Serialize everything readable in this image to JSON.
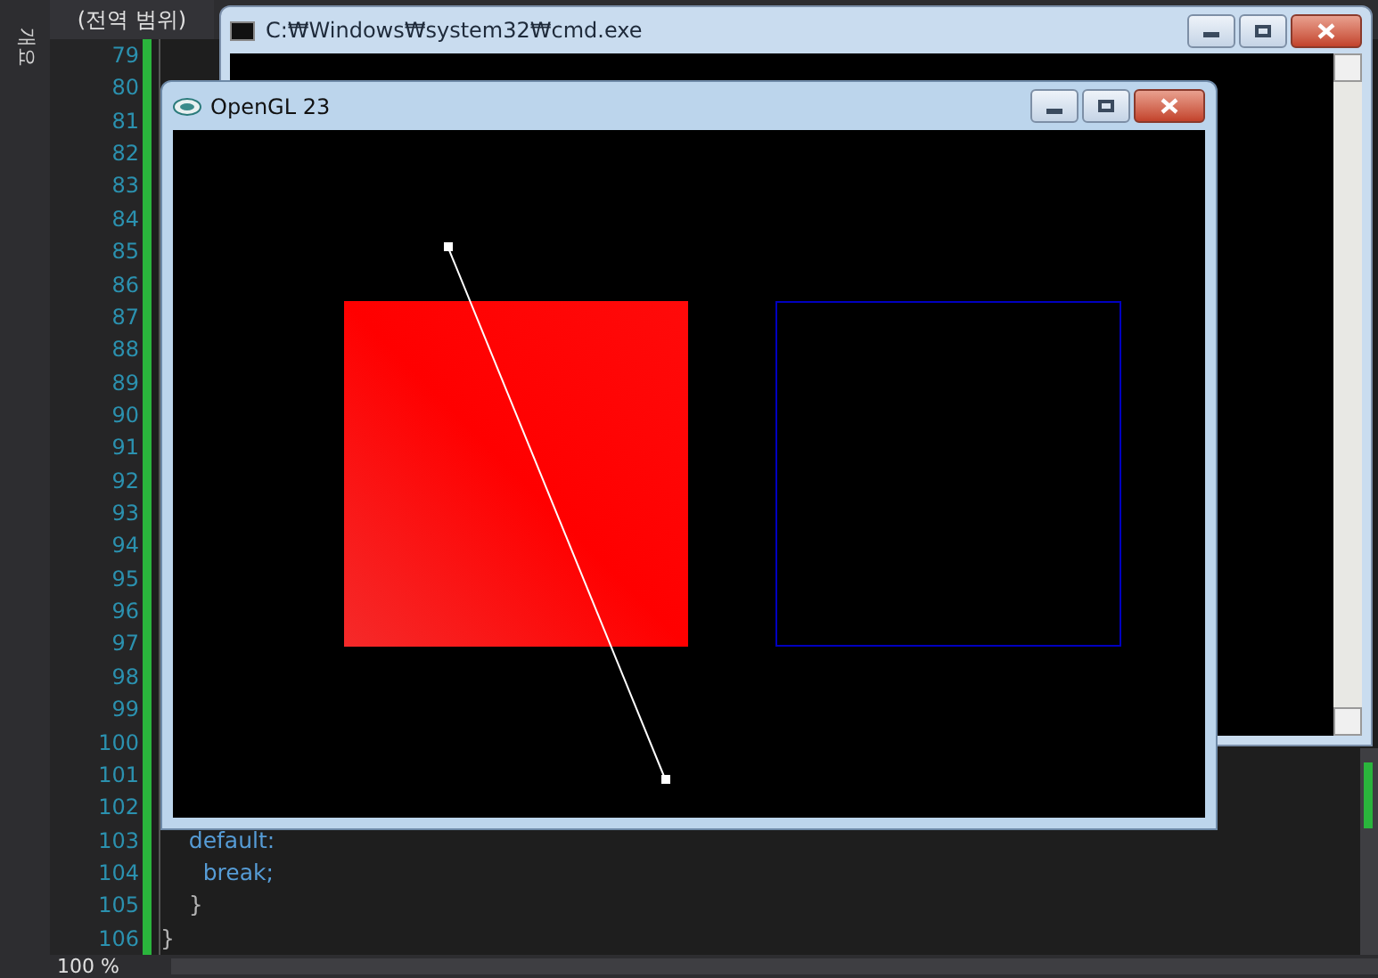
{
  "editor": {
    "side_tab": "개요",
    "scope_dropdown": "(전역 범위)",
    "zoom": "100 %",
    "lines": [
      {
        "number": "79"
      },
      {
        "number": "80"
      },
      {
        "number": "81"
      },
      {
        "number": "82"
      },
      {
        "number": "83"
      },
      {
        "number": "84"
      },
      {
        "number": "85"
      },
      {
        "number": "86"
      },
      {
        "number": "87"
      },
      {
        "number": "88"
      },
      {
        "number": "89"
      },
      {
        "number": "90"
      },
      {
        "number": "91"
      },
      {
        "number": "92"
      },
      {
        "number": "93"
      },
      {
        "number": "94"
      },
      {
        "number": "95"
      },
      {
        "number": "96"
      },
      {
        "number": "97"
      },
      {
        "number": "98"
      },
      {
        "number": "99"
      },
      {
        "number": "100"
      },
      {
        "number": "101"
      },
      {
        "number": "102"
      },
      {
        "number": "103",
        "code": "    default:",
        "kind": "keyword"
      },
      {
        "number": "104",
        "code": "      break;",
        "kind": "keyword"
      },
      {
        "number": "105",
        "code": "    }",
        "kind": "brace"
      },
      {
        "number": "106",
        "code": "}",
        "kind": "brace"
      }
    ]
  },
  "console_window": {
    "title": "C:₩Windows₩system32₩cmd.exe"
  },
  "opengl_window": {
    "title": "OpenGL 23"
  }
}
